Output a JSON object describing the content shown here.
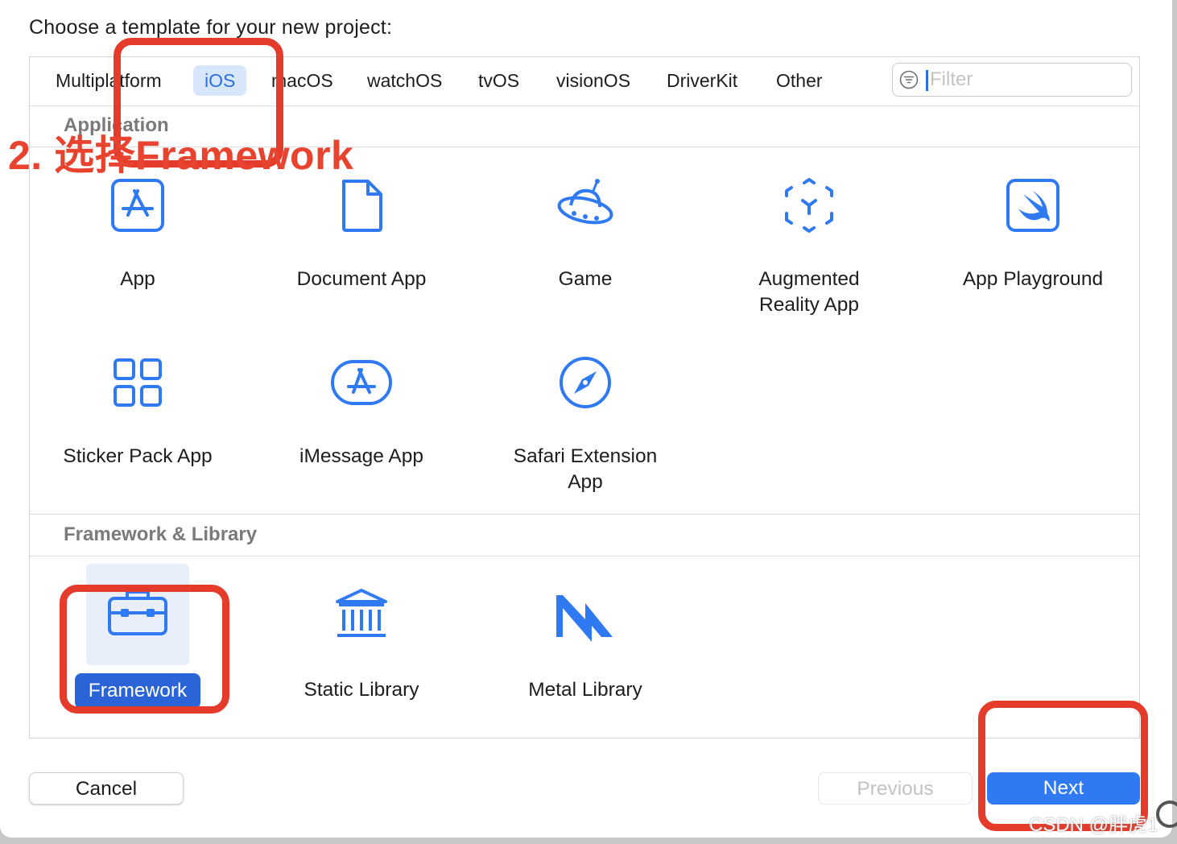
{
  "heading": "Choose a template for your new project:",
  "tabs": [
    {
      "label": "Multiplatform",
      "selected": false
    },
    {
      "label": "iOS",
      "selected": true
    },
    {
      "label": "macOS",
      "selected": false
    },
    {
      "label": "watchOS",
      "selected": false
    },
    {
      "label": "tvOS",
      "selected": false
    },
    {
      "label": "visionOS",
      "selected": false
    },
    {
      "label": "DriverKit",
      "selected": false
    },
    {
      "label": "Other",
      "selected": false
    }
  ],
  "filter": {
    "placeholder": "Filter",
    "value": ""
  },
  "sections": {
    "application": {
      "title": "Application",
      "items": [
        {
          "label": "App",
          "icon": "app-store-icon"
        },
        {
          "label": "Document App",
          "icon": "document-icon"
        },
        {
          "label": "Game",
          "icon": "game-ufo-icon"
        },
        {
          "label": "Augmented\nReality App",
          "icon": "ar-cube-icon"
        },
        {
          "label": "App Playground",
          "icon": "swift-icon"
        },
        {
          "label": "Sticker Pack App",
          "icon": "grid-icon"
        },
        {
          "label": "iMessage App",
          "icon": "imessage-app-icon"
        },
        {
          "label": "Safari Extension\nApp",
          "icon": "compass-icon"
        }
      ]
    },
    "framework": {
      "title": "Framework & Library",
      "items": [
        {
          "label": "Framework",
          "icon": "toolbox-icon",
          "selected": true
        },
        {
          "label": "Static Library",
          "icon": "library-building-icon"
        },
        {
          "label": "Metal Library",
          "icon": "metal-icon"
        }
      ]
    }
  },
  "buttons": {
    "cancel": "Cancel",
    "previous": "Previous",
    "next": "Next"
  },
  "annotation": {
    "text": "2. 选择Framework",
    "color": "#e53b2a"
  },
  "watermark": "CSDN @胖虎1",
  "colors": {
    "accent": "#2f7af3",
    "icon_blue": "#2f7af3",
    "selected_tab_bg": "#d7e6fb"
  }
}
